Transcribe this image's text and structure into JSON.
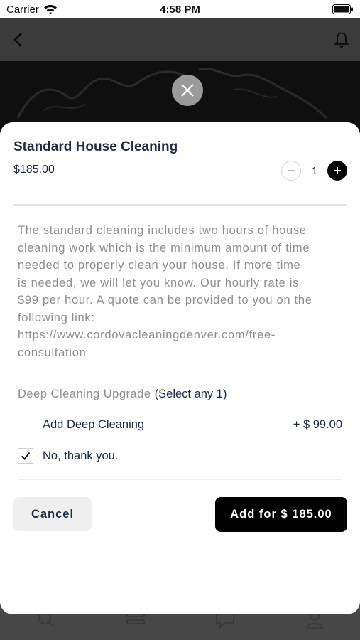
{
  "status_bar": {
    "carrier": "Carrier",
    "time": "4:58 PM"
  },
  "icons": {
    "back": "chevron-left-icon",
    "notifications": "bell-icon",
    "close": "close-icon",
    "qty_minus": "minus-icon",
    "qty_plus": "plus-icon",
    "checkmark": "check-icon"
  },
  "sheet": {
    "title": "Standard House Cleaning",
    "price": "$185.00",
    "quantity": "1",
    "description_lines": [
      "The standard cleaning includes two hours of house",
      "cleaning work which is the minimum amount of time",
      "needed to properly clean your house. If more time",
      "is needed, we will let you know. Our hourly rate is",
      "$99 per hour. A quote can be provided to you on the",
      "following link:",
      "https://www.cordovacleaningdenver.com/free-",
      "consultation"
    ],
    "upgrade": {
      "title": "Deep Cleaning Upgrade",
      "note": "(Select any 1)",
      "options": [
        {
          "label": "Add Deep Cleaning",
          "price": "+ $ 99.00",
          "checked": false
        },
        {
          "label": "No, thank you.",
          "price": "",
          "checked": true
        }
      ]
    },
    "cancel_label": "Cancel",
    "add_label": "Add for $ 185.00"
  },
  "colors": {
    "primary_text": "#1d2a44",
    "muted_text": "#8e8e8e",
    "accent": "#000000"
  }
}
